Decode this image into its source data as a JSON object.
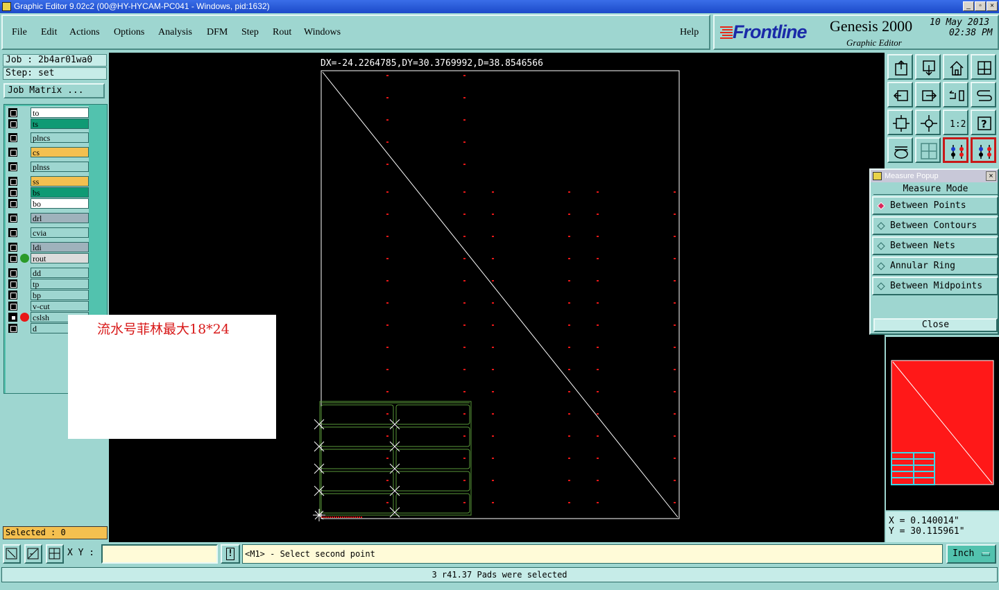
{
  "window": {
    "title": "Graphic Editor 9.02c2 (00@HY-HYCAM-PC041 - Windows, pid:1632)",
    "controls": [
      "_",
      "▫",
      "×"
    ]
  },
  "menu": [
    "File",
    "Edit",
    "Actions",
    "Options",
    "Analysis",
    "DFM",
    "Step",
    "Rout",
    "Windows"
  ],
  "help_label": "Help",
  "brand": {
    "logo": "Frontline",
    "product": "Genesis 2000",
    "subtitle": "Graphic Editor",
    "date": "10 May 2013",
    "time": "02:38 PM"
  },
  "job": {
    "job_label": "Job : 2b4ar01wa0",
    "step_label": "Step: set",
    "matrix_button": "Job Matrix ..."
  },
  "layers": [
    {
      "name": "to",
      "color": "#ffffff",
      "state": "off"
    },
    {
      "name": "ts",
      "color": "#0f9a74",
      "state": "off"
    },
    {
      "name": "plncs",
      "color": "#9ed6d0",
      "state": "off"
    },
    {
      "name": "cs",
      "color": "#f4c050",
      "state": "off"
    },
    {
      "name": "plnss",
      "color": "#9ed6d0",
      "state": "off"
    },
    {
      "name": "ss",
      "color": "#f4c050",
      "state": "off"
    },
    {
      "name": "bs",
      "color": "#0f9a74",
      "state": "off"
    },
    {
      "name": "bo",
      "color": "#ffffff",
      "state": "off"
    },
    {
      "name": "drl",
      "color": "#9fb2bc",
      "state": "off"
    },
    {
      "name": "cvia",
      "color": "#9ed6d0",
      "state": "off"
    },
    {
      "name": "ldi",
      "color": "#9fb2bc",
      "state": "off"
    },
    {
      "name": "rout",
      "color": "#dcdcdc",
      "state": "off",
      "dot": "#2a9a28"
    },
    {
      "name": "dd",
      "color": "#9ed6d0",
      "state": "off"
    },
    {
      "name": "tp",
      "color": "#9ed6d0",
      "state": "off"
    },
    {
      "name": "bp",
      "color": "#9ed6d0",
      "state": "off"
    },
    {
      "name": "v-cut",
      "color": "#9ed6d0",
      "state": "off"
    },
    {
      "name": "cslsh",
      "color": "#9ed6d0",
      "state": "work",
      "dot": "#e81818"
    },
    {
      "name": "d",
      "color": "#9ed6d0",
      "state": "off"
    }
  ],
  "selected_label": "Selected : 0",
  "measure_readout": "DX=-24.2264785,DY=30.3769992,D=38.8546566",
  "overlay_note": "流水号菲林最大18*24",
  "toolbox": [
    "upload-icon",
    "download-icon",
    "home-icon",
    "window-icon",
    "zoom-back-icon",
    "zoom-forward-icon",
    "swap-icon",
    "redraw-icon",
    "fit-icon",
    "center-icon",
    "scale-1-2-icon",
    "help-icon",
    "snap-icon",
    "grid-icon",
    "layers-a-icon",
    "layers-b-icon"
  ],
  "toolbox_scale_text": "1:2",
  "toolbox_help_text": "?",
  "measure_popup": {
    "title": "Measure Popup",
    "mode_label": "Measure Mode",
    "options": [
      {
        "label": "Between Points",
        "selected": true
      },
      {
        "label": "Between Contours",
        "selected": false
      },
      {
        "label": "Between Nets",
        "selected": false
      },
      {
        "label": "Annular Ring",
        "selected": false
      },
      {
        "label": "Between Midpoints",
        "selected": false
      }
    ],
    "close_label": "Close"
  },
  "coords": {
    "x": "X = 0.140014\"",
    "y": "Y = 30.115961\""
  },
  "bottom": {
    "xy_label": "X Y :",
    "xy_value": "",
    "prompt": "<M1> - Select second point",
    "units": "Inch",
    "status": "3 r41.37 Pads were selected"
  },
  "colors": {
    "background": "#9ed6d0",
    "canvas": "#000000",
    "red_pad": "#e81818",
    "green_rout": "#5a9a3a",
    "overview_fill": "#ff1818"
  }
}
